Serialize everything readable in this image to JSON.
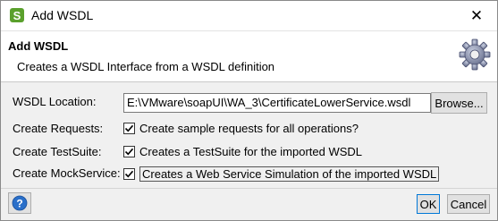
{
  "window": {
    "title": "Add WSDL",
    "close_glyph": "✕"
  },
  "header": {
    "title": "Add WSDL",
    "description": "Creates a WSDL Interface from a WSDL definition",
    "icon": "gear-icon"
  },
  "form": {
    "wsdl_location": {
      "label": "WSDL Location:",
      "value": "E:\\VMware\\soapUI\\WA_3\\CertificateLowerService.wsdl",
      "browse_label": "Browse..."
    },
    "create_requests": {
      "label": "Create Requests:",
      "checked": true,
      "text": "Create sample requests for all operations?"
    },
    "create_testsuite": {
      "label": "Create TestSuite:",
      "checked": true,
      "text": "Creates a TestSuite for the imported WSDL"
    },
    "create_mockservice": {
      "label": "Create MockService:",
      "checked": true,
      "text": "Creates a Web Service Simulation of the imported WSDL"
    }
  },
  "footer": {
    "help_icon": "help-icon",
    "ok_label": "OK",
    "cancel_label": "Cancel"
  },
  "colors": {
    "accent": "#0078d7",
    "soapui_green": "#5aa02c",
    "help_blue": "#2a6fc9"
  }
}
